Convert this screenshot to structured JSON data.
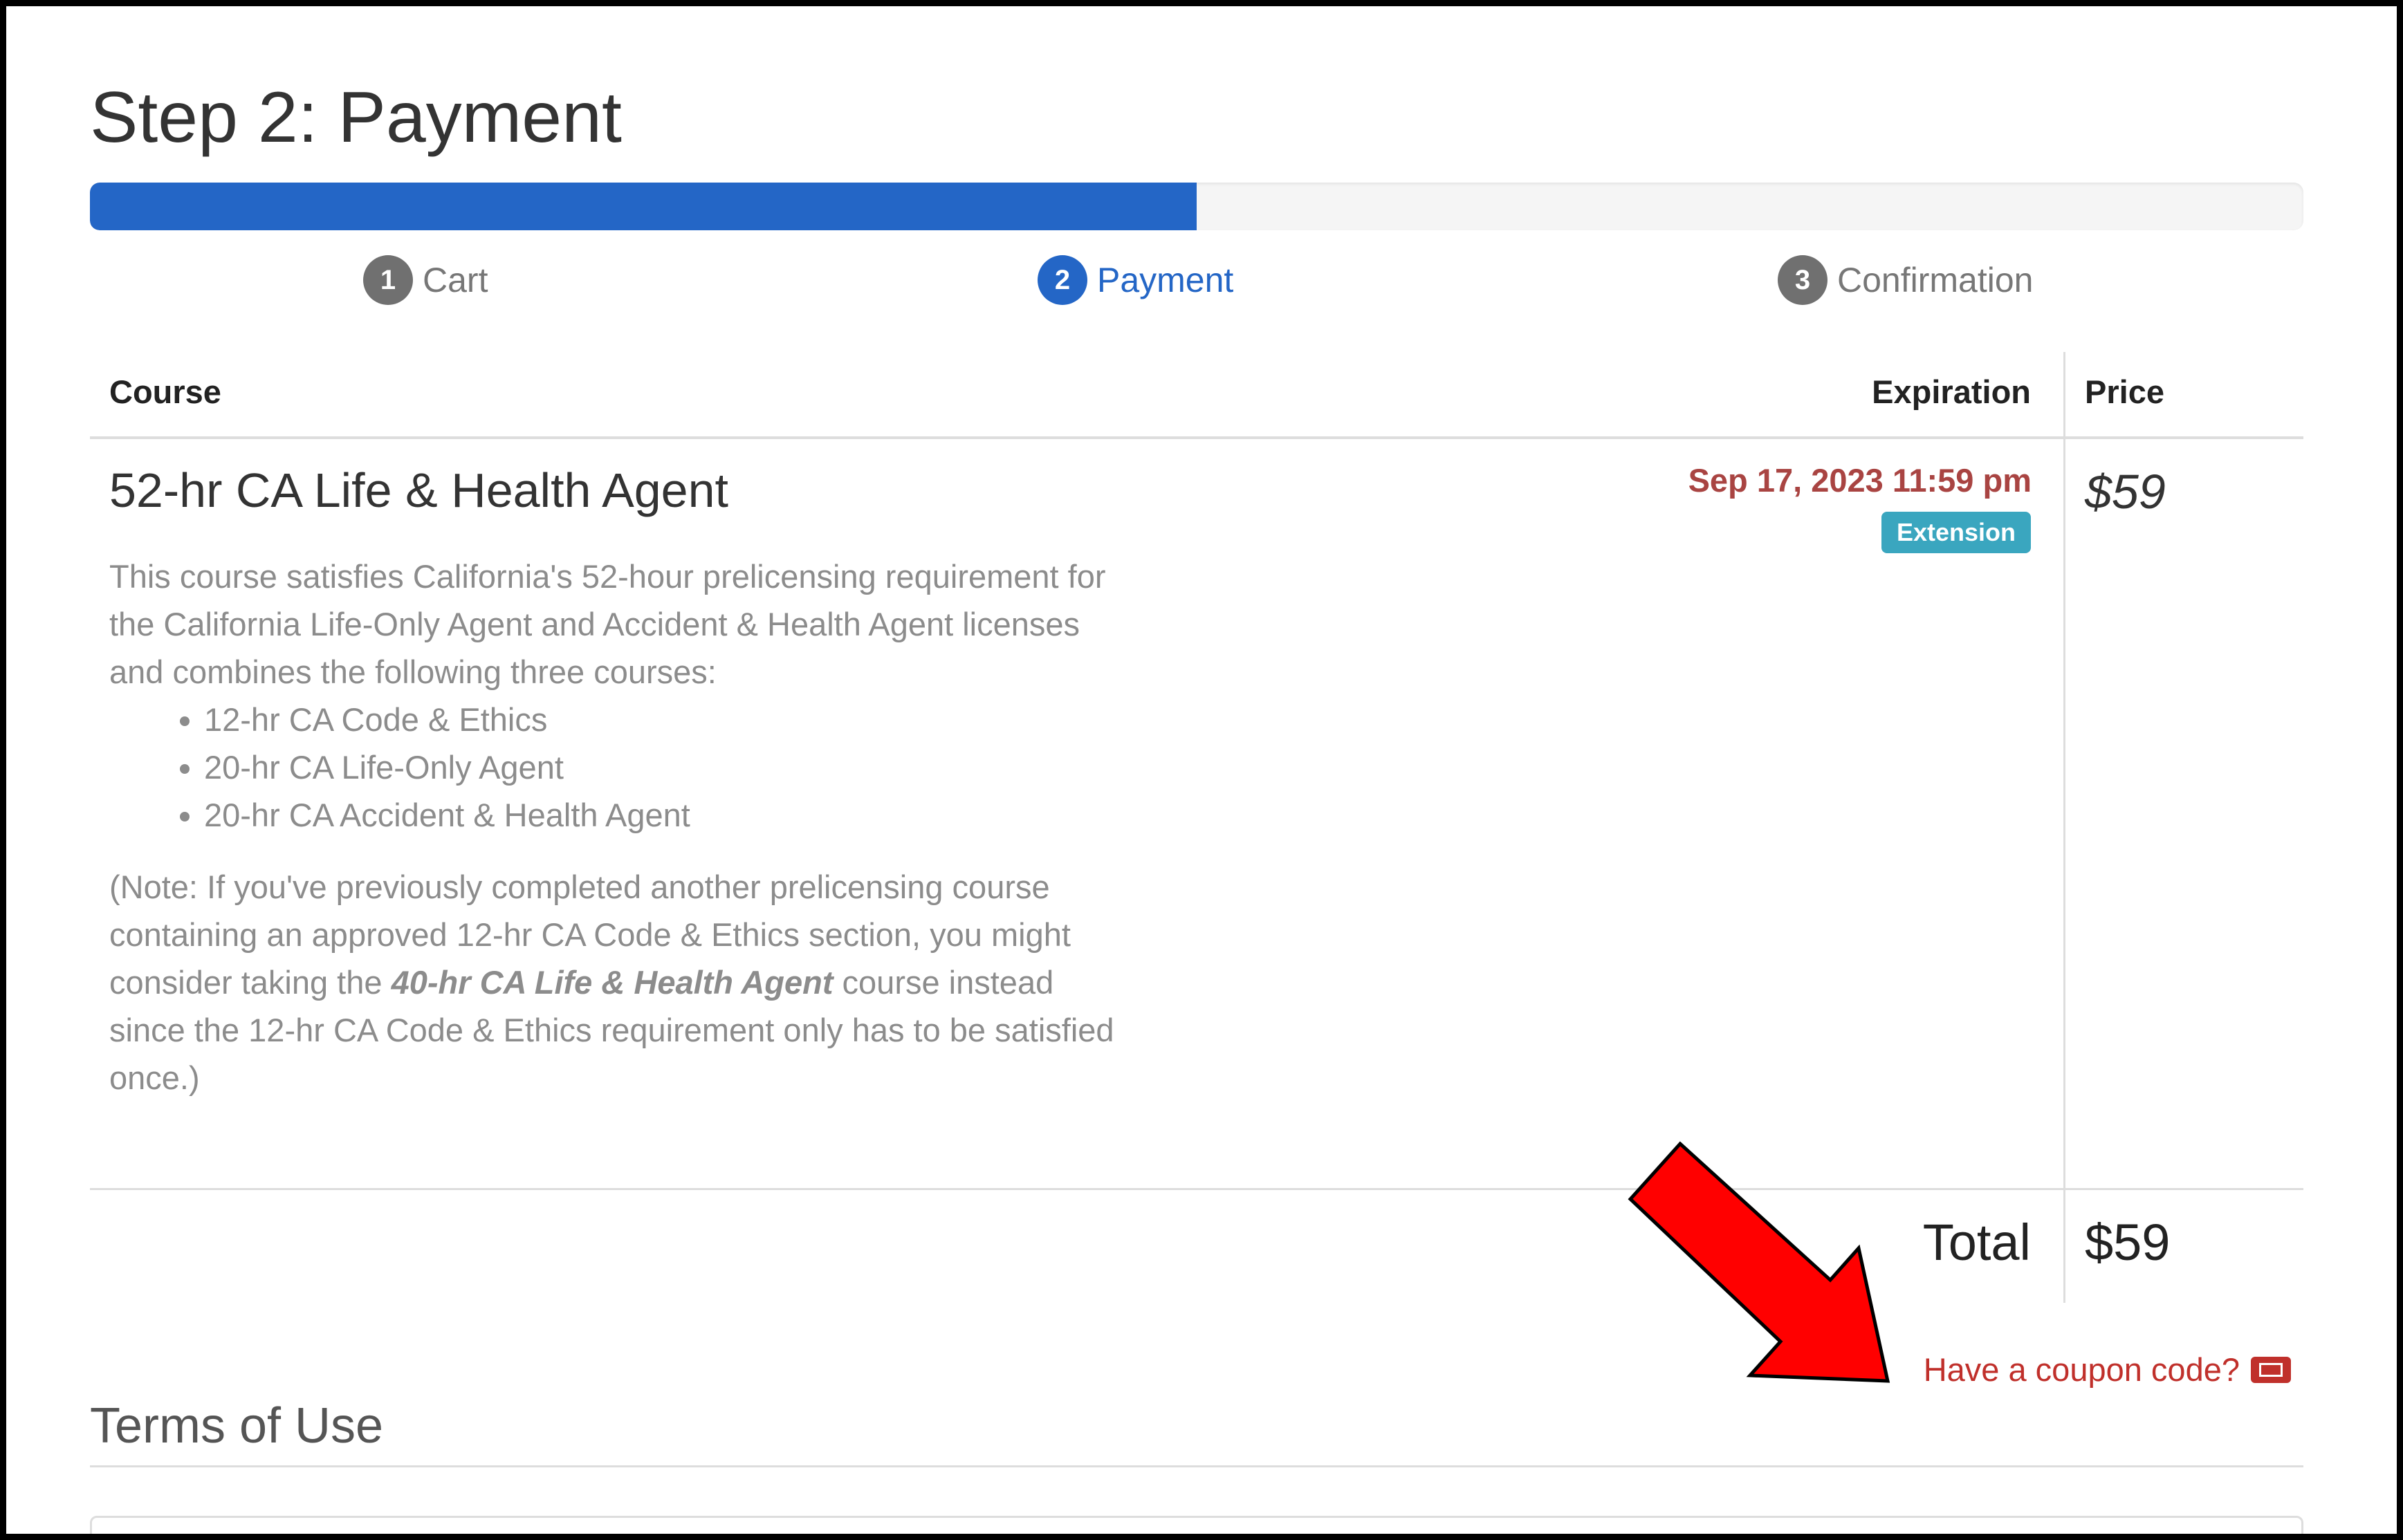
{
  "page": {
    "title": "Step 2: Payment"
  },
  "progress": {
    "value": 0.5
  },
  "steps": [
    {
      "number": "1",
      "label": "Cart",
      "active": false
    },
    {
      "number": "2",
      "label": "Payment",
      "active": true
    },
    {
      "number": "3",
      "label": "Confirmation",
      "active": false
    }
  ],
  "table": {
    "headers": {
      "course": "Course",
      "expiration": "Expiration",
      "price": "Price"
    },
    "row": {
      "title": "52-hr CA Life & Health Agent",
      "description": "This course satisfies California's 52-hour prelicensing requirement for the California Life-Only Agent and Accident & Health Agent licenses and combines the following three courses:",
      "courses": [
        "12-hr CA Code & Ethics",
        "20-hr CA Life-Only Agent",
        "20-hr CA Accident & Health Agent"
      ],
      "note_before": "(Note: If you've previously completed another prelicensing course containing an approved 12-hr CA Code & Ethics section, you might consider taking the ",
      "note_emphasis": "40-hr CA Life & Health Agent",
      "note_after": " course instead since the 12-hr CA Code & Ethics requirement only has to be satisfied once.)",
      "expiration": "Sep 17, 2023 11:59 pm",
      "badge": "Extension",
      "price": "$59"
    },
    "total": {
      "label": "Total",
      "value": "$59"
    }
  },
  "coupon": {
    "label": "Have a coupon code?",
    "icon": "ticket-icon"
  },
  "terms": {
    "title": "Terms of Use"
  },
  "colors": {
    "primary": "#2466c6",
    "danger": "#a94442",
    "info": "#3aa6bf",
    "coupon": "#c0302b",
    "annotation_arrow": "#ff0000"
  }
}
